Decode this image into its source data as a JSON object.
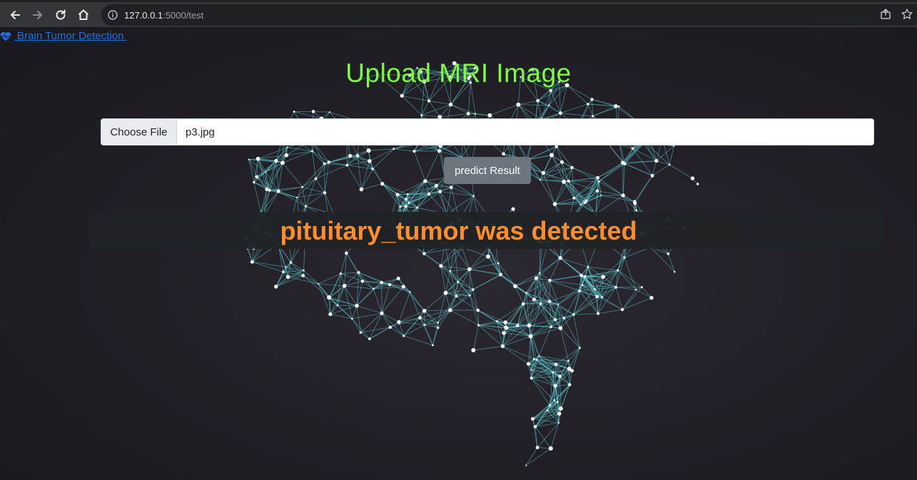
{
  "browser": {
    "url_host": "127.0.0.1",
    "url_path": ":5000/test"
  },
  "nav": {
    "brand_label": " Brain Tumor Detection ",
    "brand_icon": "heart-pulse-icon"
  },
  "main": {
    "title": "Upload MRI Image",
    "file_button_label": "Choose File",
    "file_name": "p3.jpg",
    "predict_button_label": "predict Result",
    "result_text": "pituitary_tumor was detected"
  },
  "colors": {
    "title": "#7cfc3a",
    "result": "#fd8d2c",
    "link": "#1a73e8",
    "button": "#6c757d",
    "network": "#5fd6d8"
  }
}
